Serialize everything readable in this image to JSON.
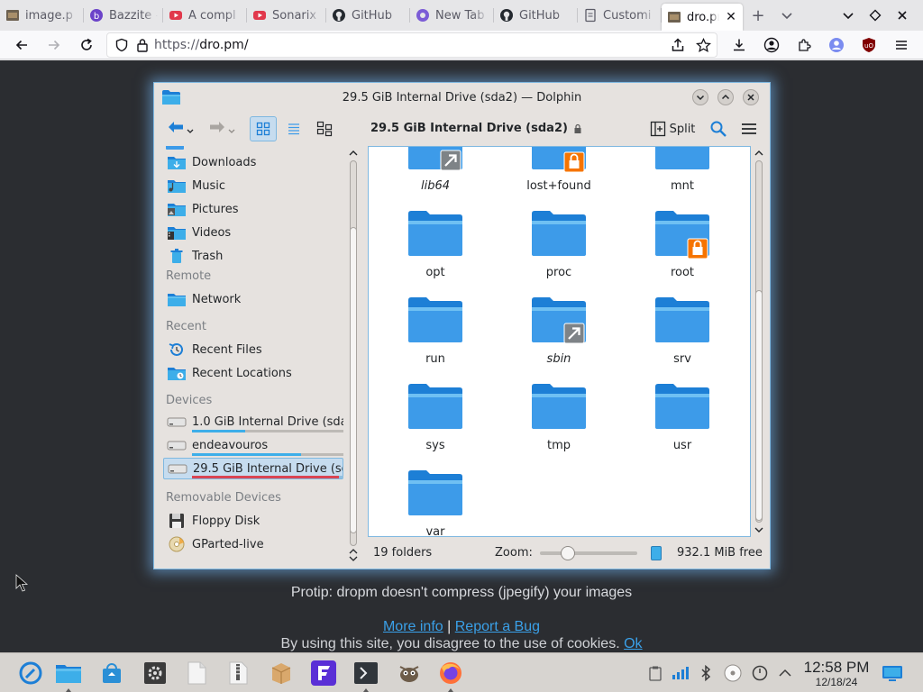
{
  "browser": {
    "tabs": [
      {
        "label": "image.p",
        "icon": "image-tab-icon"
      },
      {
        "label": "Bazzite –",
        "icon": "bazzite-icon"
      },
      {
        "label": "A compl",
        "icon": "youtube-icon"
      },
      {
        "label": "Sonarix",
        "icon": "youtube-icon"
      },
      {
        "label": "GitHub",
        "icon": "github-icon"
      },
      {
        "label": "New Tab",
        "icon": "firefox-newtab-icon"
      },
      {
        "label": "GitHub",
        "icon": "github-icon"
      },
      {
        "label": "Customi",
        "icon": "page-icon"
      },
      {
        "label": "dro.pr",
        "icon": "image-tab-icon",
        "active": true
      }
    ],
    "url_protocol": "https://",
    "url_host": "dro.pm/"
  },
  "dolphin": {
    "title": "29.5 GiB Internal Drive (sda2) — Dolphin",
    "location": "29.5 GiB Internal Drive (sda2)",
    "split_label": "Split",
    "sidebar": {
      "places": [
        {
          "label": "Downloads",
          "icon": "downloads-folder-icon"
        },
        {
          "label": "Music",
          "icon": "music-folder-icon"
        },
        {
          "label": "Pictures",
          "icon": "pictures-folder-icon"
        },
        {
          "label": "Videos",
          "icon": "videos-folder-icon"
        },
        {
          "label": "Trash",
          "icon": "trash-icon"
        }
      ],
      "remote_heading": "Remote",
      "remote": [
        {
          "label": "Network",
          "icon": "network-folder-icon"
        }
      ],
      "recent_heading": "Recent",
      "recent": [
        {
          "label": "Recent Files",
          "icon": "recent-files-icon"
        },
        {
          "label": "Recent Locations",
          "icon": "recent-locations-icon"
        }
      ],
      "devices_heading": "Devices",
      "devices": [
        {
          "label": "1.0 GiB Internal Drive (sda1)",
          "icon": "drive-icon",
          "usage_color": "#3daee9"
        },
        {
          "label": "endeavouros",
          "icon": "drive-icon",
          "usage_color": "#3daee9"
        },
        {
          "label": "29.5 GiB Internal Drive (sd...",
          "icon": "drive-icon",
          "usage_color": "#da4453",
          "active": true
        }
      ],
      "removable_heading": "Removable Devices",
      "removable": [
        {
          "label": "Floppy Disk",
          "icon": "floppy-icon"
        },
        {
          "label": "GParted-live",
          "icon": "optical-disc-icon"
        }
      ]
    },
    "files": [
      {
        "name": "lib64",
        "italic": true,
        "badge": "link"
      },
      {
        "name": "lost+found",
        "italic": false,
        "badge": "lock"
      },
      {
        "name": "mnt",
        "italic": false,
        "badge": ""
      },
      {
        "name": "opt",
        "italic": false,
        "badge": ""
      },
      {
        "name": "proc",
        "italic": false,
        "badge": ""
      },
      {
        "name": "root",
        "italic": false,
        "badge": "lock"
      },
      {
        "name": "run",
        "italic": false,
        "badge": ""
      },
      {
        "name": "sbin",
        "italic": true,
        "badge": "link"
      },
      {
        "name": "srv",
        "italic": false,
        "badge": ""
      },
      {
        "name": "sys",
        "italic": false,
        "badge": ""
      },
      {
        "name": "tmp",
        "italic": false,
        "badge": ""
      },
      {
        "name": "usr",
        "italic": false,
        "badge": ""
      },
      {
        "name": "var",
        "italic": false,
        "badge": ""
      }
    ],
    "status": {
      "folder_count": "19 folders",
      "zoom_label": "Zoom:",
      "zoom_level": 0.25,
      "free_space": "932.1 MiB free"
    }
  },
  "page": {
    "protip": "Protip: dropm doesn't compress (jpegify) your images",
    "more_info": "More info",
    "separator": "|",
    "report_bug": "Report a Bug",
    "cookie_text": "By using this site, you disagree to the use of cookies.",
    "cookie_ok": "Ok"
  },
  "taskbar": {
    "time": "12:58 PM",
    "date": "12/18/24",
    "apps": [
      "app-launcher-icon",
      "dolphin-icon",
      "discover-icon",
      "system-settings-icon",
      "text-editor-icon",
      "archive-icon",
      "package-icon",
      "endeavouros-welcome-icon",
      "konsole-icon",
      "gimp-icon",
      "firefox-icon"
    ]
  },
  "colors": {
    "accent": "#3daee9",
    "selection": "#c6dcef",
    "folder_blue": "#3d9be9",
    "page_bg": "#2b2d31",
    "link": "#3aa0e8"
  }
}
